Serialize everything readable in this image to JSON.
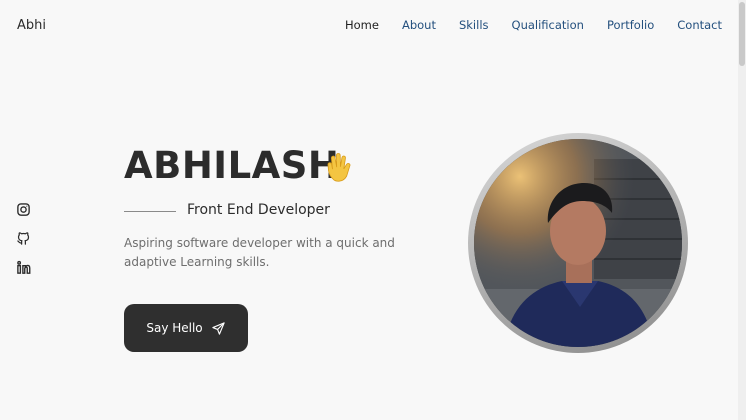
{
  "header": {
    "brand": "Abhi",
    "nav": [
      {
        "label": "Home",
        "active": true
      },
      {
        "label": "About"
      },
      {
        "label": "Skills"
      },
      {
        "label": "Qualification"
      },
      {
        "label": "Portfolio"
      },
      {
        "label": "Contact"
      }
    ]
  },
  "social": {
    "icons": [
      "instagram-icon",
      "github-icon",
      "linkedin-icon"
    ]
  },
  "hero": {
    "name": "ABHILASH",
    "wave_icon": "waving-hand-icon",
    "subtitle": "Front End Developer",
    "description": "Aspiring software developer with a quick and adaptive Learning skills.",
    "button_label": "Say Hello",
    "button_icon": "send-icon"
  },
  "colors": {
    "background": "#f8f8f8",
    "title": "#2c2c2c",
    "nav_link": "#24507e",
    "button_bg": "#2f2f2f"
  }
}
